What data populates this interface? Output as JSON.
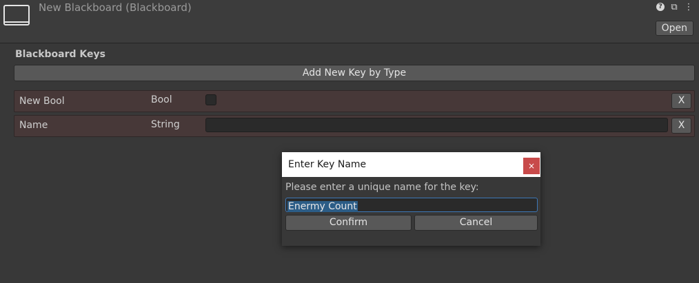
{
  "header": {
    "title": "New Blackboard (Blackboard)",
    "icons": [
      "help-icon",
      "sliders-icon",
      "more-vert-icon"
    ],
    "open_label": "Open"
  },
  "keys_section": {
    "title": "Blackboard Keys",
    "add_button_label": "Add New Key by Type",
    "rows": [
      {
        "name": "New Bool",
        "type": "Bool",
        "value": false,
        "remove_label": "X"
      },
      {
        "name": "Name",
        "type": "String",
        "value": "",
        "remove_label": "X"
      }
    ]
  },
  "dialog": {
    "title": "Enter Key Name",
    "close_label": "×",
    "prompt": "Please enter a unique name for the key:",
    "input_value": "Enermy Count",
    "confirm_label": "Confirm",
    "cancel_label": "Cancel"
  },
  "colors": {
    "background": "#383838",
    "row_background": "#473838",
    "close_button": "#c84a4a",
    "selection": "#2c5d87",
    "focus_border": "#3e78b8"
  }
}
